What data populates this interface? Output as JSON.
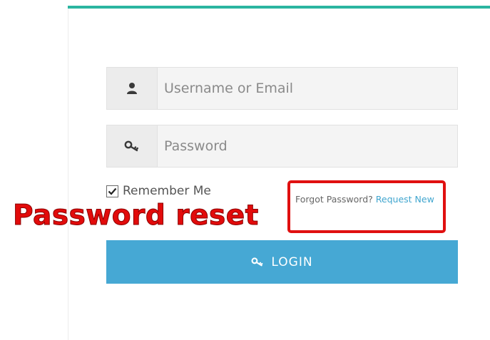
{
  "form": {
    "username_placeholder": "Username or Email",
    "password_placeholder": "Password",
    "remember_label": "Remember Me",
    "remember_checked": true,
    "forgot_text": "Forgot Password?",
    "forgot_link": "Request New",
    "login_label": "LOGIN",
    "username_icon": "user-icon",
    "password_icon": "key-icon",
    "login_icon": "key-icon"
  },
  "annotation": {
    "text": "Password reset",
    "color": "#e20b0b"
  },
  "colors": {
    "accent": "#2bb5a0",
    "button": "#46a8d4",
    "link": "#41a6cf"
  }
}
